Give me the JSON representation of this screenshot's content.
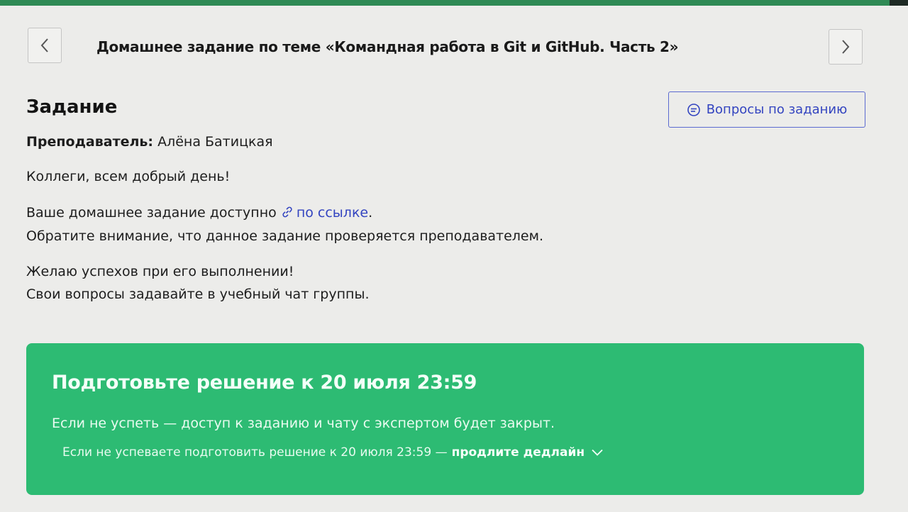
{
  "header": {
    "title": "Домашнее задание по теме «Командная работа в Git и GitHub. Часть 2»"
  },
  "nav": {
    "prev_icon": "chevron-left-icon",
    "next_icon": "chevron-right-icon"
  },
  "task": {
    "heading": "Задание",
    "questions_button": "Вопросы по заданию",
    "questions_icon": "chat-bubble-icon",
    "teacher_label": "Преподаватель:",
    "teacher_name": "Алёна Батицкая",
    "greeting": "Коллеги, всем добрый день!",
    "hw_prefix": "Ваше домашнее задание доступно",
    "hw_link": "по ссылке",
    "hw_suffix": ".",
    "hw_note": "Обратите внимание, что данное задание проверяется преподавателем.",
    "wish": "Желаю успехов при его выполнении!",
    "questions_note": "Свои вопросы задавайте в учебный чат группы."
  },
  "deadline": {
    "title": "Подготовьте решение к 20 июля 23:59",
    "subtitle": "Если не успеть — доступ к заданию и чату с экспертом будет закрыт.",
    "extend_prefix": "Если не успеваете подготовить решение к 20 июля 23:59 —",
    "extend_link": "продлите дедлайн",
    "extend_icon": "chevron-down-icon"
  },
  "colors": {
    "accent_green": "#2dbb73",
    "link_blue": "#3344c0"
  }
}
